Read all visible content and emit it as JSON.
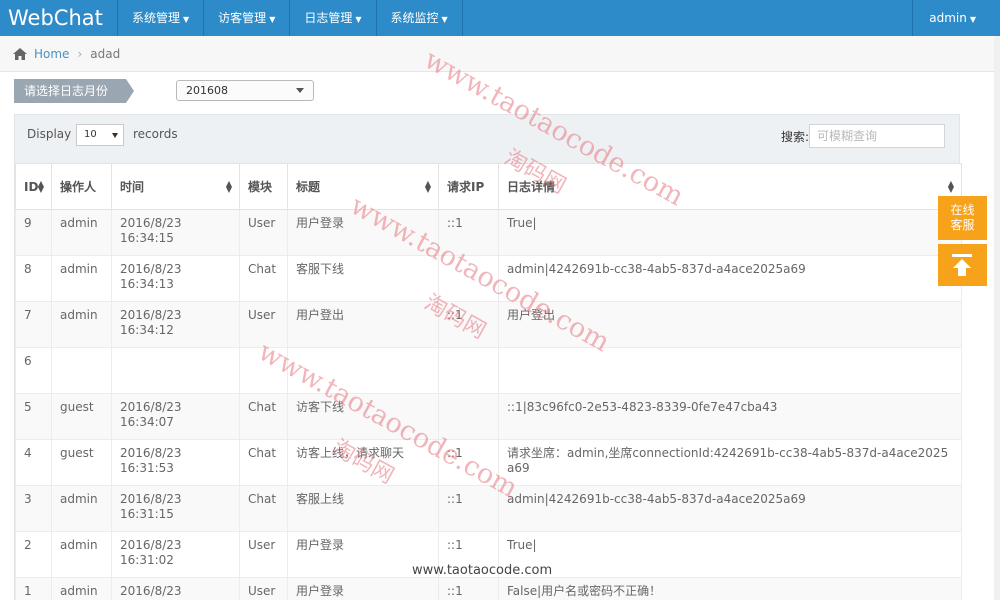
{
  "navbar": {
    "brand": "WebChat",
    "menus": [
      {
        "label": "系统管理"
      },
      {
        "label": "访客管理"
      },
      {
        "label": "日志管理"
      },
      {
        "label": "系统监控"
      }
    ],
    "user": "admin",
    "bg_color": "#2e8bc9"
  },
  "breadcrumb": {
    "home": "Home",
    "current": "adad"
  },
  "month_filter": {
    "label": "请选择日志月份",
    "selected": "201608"
  },
  "table_controls": {
    "display_label": "Display",
    "page_size": "10",
    "records_label": "records",
    "search_label": "搜索:",
    "search_placeholder": "可模糊查询"
  },
  "table": {
    "headers": [
      "ID",
      "操作人",
      "时间",
      "模块",
      "标题",
      "请求IP",
      "日志详情"
    ],
    "rows": [
      {
        "id": "9",
        "user": "admin",
        "date": "2016/8/23",
        "time": "16:34:15",
        "module": "User",
        "title": "用户登录",
        "ip": "::1",
        "detail": "True|"
      },
      {
        "id": "8",
        "user": "admin",
        "date": "2016/8/23",
        "time": "16:34:13",
        "module": "Chat",
        "title": "客服下线",
        "ip": "",
        "detail": "admin|4242691b-cc38-4ab5-837d-a4ace2025a69"
      },
      {
        "id": "7",
        "user": "admin",
        "date": "2016/8/23",
        "time": "16:34:12",
        "module": "User",
        "title": "用户登出",
        "ip": "::1",
        "detail": "用户登出"
      },
      {
        "id": "6",
        "user": "",
        "date": "",
        "time": "",
        "module": "",
        "title": "",
        "ip": "",
        "detail": ""
      },
      {
        "id": "5",
        "user": "guest",
        "date": "2016/8/23",
        "time": "16:34:07",
        "module": "Chat",
        "title": "访客下线",
        "ip": "",
        "detail": "::1|83c96fc0-2e53-4823-8339-0fe7e47cba43"
      },
      {
        "id": "4",
        "user": "guest",
        "date": "2016/8/23",
        "time": "16:31:53",
        "module": "Chat",
        "title": "访客上线，请求聊天",
        "ip": "::1",
        "detail": "请求坐席：admin,坐席connectionId:4242691b-cc38-4ab5-837d-a4ace2025a69"
      },
      {
        "id": "3",
        "user": "admin",
        "date": "2016/8/23",
        "time": "16:31:15",
        "module": "Chat",
        "title": "客服上线",
        "ip": "::1",
        "detail": "admin|4242691b-cc38-4ab5-837d-a4ace2025a69"
      },
      {
        "id": "2",
        "user": "admin",
        "date": "2016/8/23",
        "time": "16:31:02",
        "module": "User",
        "title": "用户登录",
        "ip": "::1",
        "detail": "True|"
      },
      {
        "id": "1",
        "user": "admin",
        "date": "2016/8/23",
        "time": "",
        "module": "User",
        "title": "用户登录",
        "ip": "::1",
        "detail": "False|用户名或密码不正确！"
      }
    ]
  },
  "float_buttons": {
    "service_line1": "在线",
    "service_line2": "客服",
    "accent_color": "#f7a21b"
  },
  "watermarks": {
    "url": "www.taotaocode.com",
    "cn": "淘码网",
    "bottom": "www.taotaocode.com"
  }
}
